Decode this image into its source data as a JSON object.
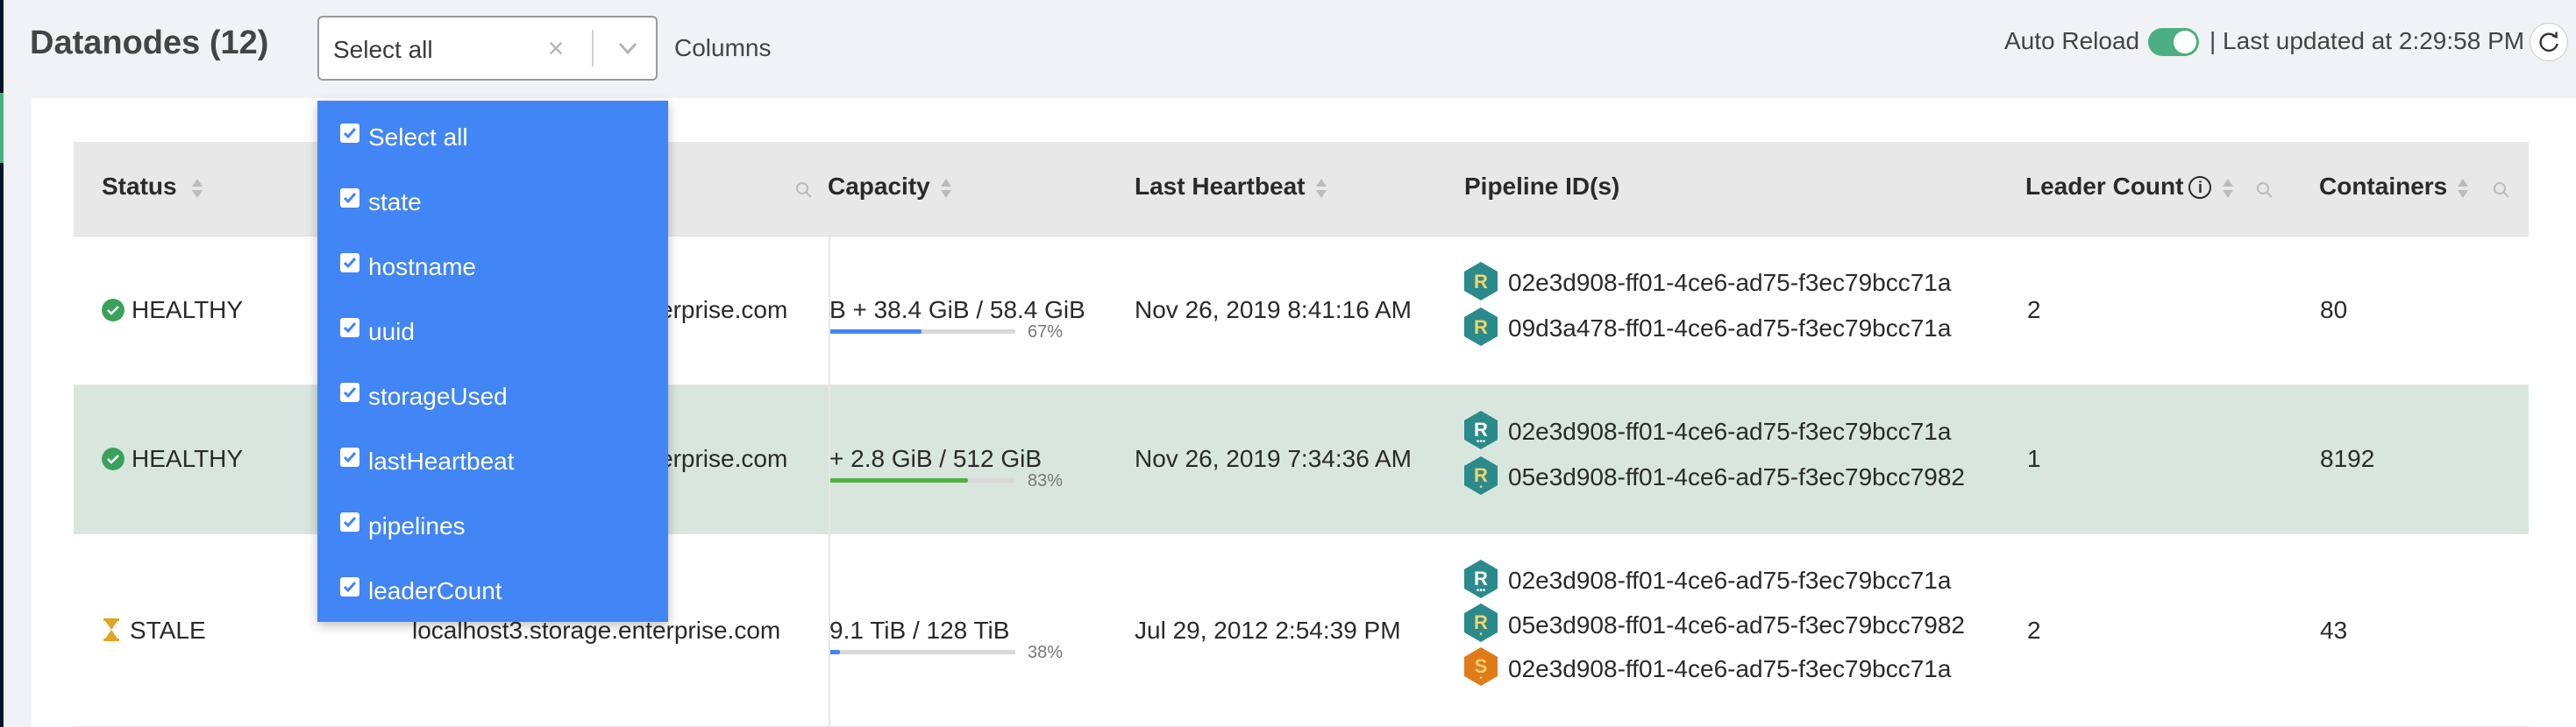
{
  "header": {
    "title": "Datanodes (12)",
    "select_value": "Select all",
    "columns_label": "Columns",
    "auto_reload_label": "Auto Reload",
    "auto_reload_on": true,
    "last_updated": "| Last updated at 2:29:58 PM"
  },
  "table": {
    "columns": [
      "Status",
      "Capacity",
      "Last Heartbeat",
      "Pipeline ID(s)",
      "Leader Count",
      "Containers"
    ],
    "rows": [
      {
        "status": "HEALTHY",
        "hostname": "erprise.com",
        "capacity": "B + 38.4 GiB / 58.4 GiB",
        "percent": "67%",
        "percent_value": 0.67,
        "heartbeat": "Nov 26, 2019 8:41:16 AM",
        "pipelines": [
          {
            "type": "R",
            "id": "02e3d908-ff01-4ce6-ad75-f3ec79bcc71a"
          },
          {
            "type": "R",
            "id": "09d3a478-ff01-4ce6-ad75-f3ec79bcc71a"
          }
        ],
        "leader_count": "2",
        "containers": "80"
      },
      {
        "status": "HEALTHY",
        "hostname": "erprise.com",
        "capacity": "+ 2.8 GiB / 512 GiB",
        "percent": "83%",
        "percent_value": 0.83,
        "heartbeat": "Nov 26, 2019 7:34:36 AM",
        "pipelines": [
          {
            "type": "R",
            "id": "02e3d908-ff01-4ce6-ad75-f3ec79bcc71a"
          },
          {
            "type": "R",
            "id": "05e3d908-ff01-4ce6-ad75-f3ec79bcc7982"
          }
        ],
        "leader_count": "1",
        "containers": "8192"
      },
      {
        "status": "STALE",
        "hostname": "localhost3.storage.enterprise.com",
        "capacity": "9.1 TiB / 128 TiB",
        "percent": "38%",
        "percent_value": 0.38,
        "heartbeat": "Jul 29, 2012 2:54:39 PM",
        "pipelines": [
          {
            "type": "R",
            "id": "02e3d908-ff01-4ce6-ad75-f3ec79bcc71a"
          },
          {
            "type": "R",
            "id": "05e3d908-ff01-4ce6-ad75-f3ec79bcc7982"
          },
          {
            "type": "S",
            "id": "02e3d908-ff01-4ce6-ad75-f3ec79bcc71a"
          }
        ],
        "leader_count": "2",
        "containers": "43"
      }
    ]
  },
  "dropdown": {
    "options": [
      "Select all",
      "state",
      "hostname",
      "uuid",
      "storageUsed",
      "lastHeartbeat",
      "pipelines",
      "leaderCount"
    ]
  },
  "colors": {
    "accent": "#4285f4",
    "healthy": "#3aa15a",
    "stale": "#e0a526",
    "row_highlight": "#d9e6dd",
    "hex_teal": "#2b8a8c",
    "hex_orange": "#e07b1a"
  }
}
